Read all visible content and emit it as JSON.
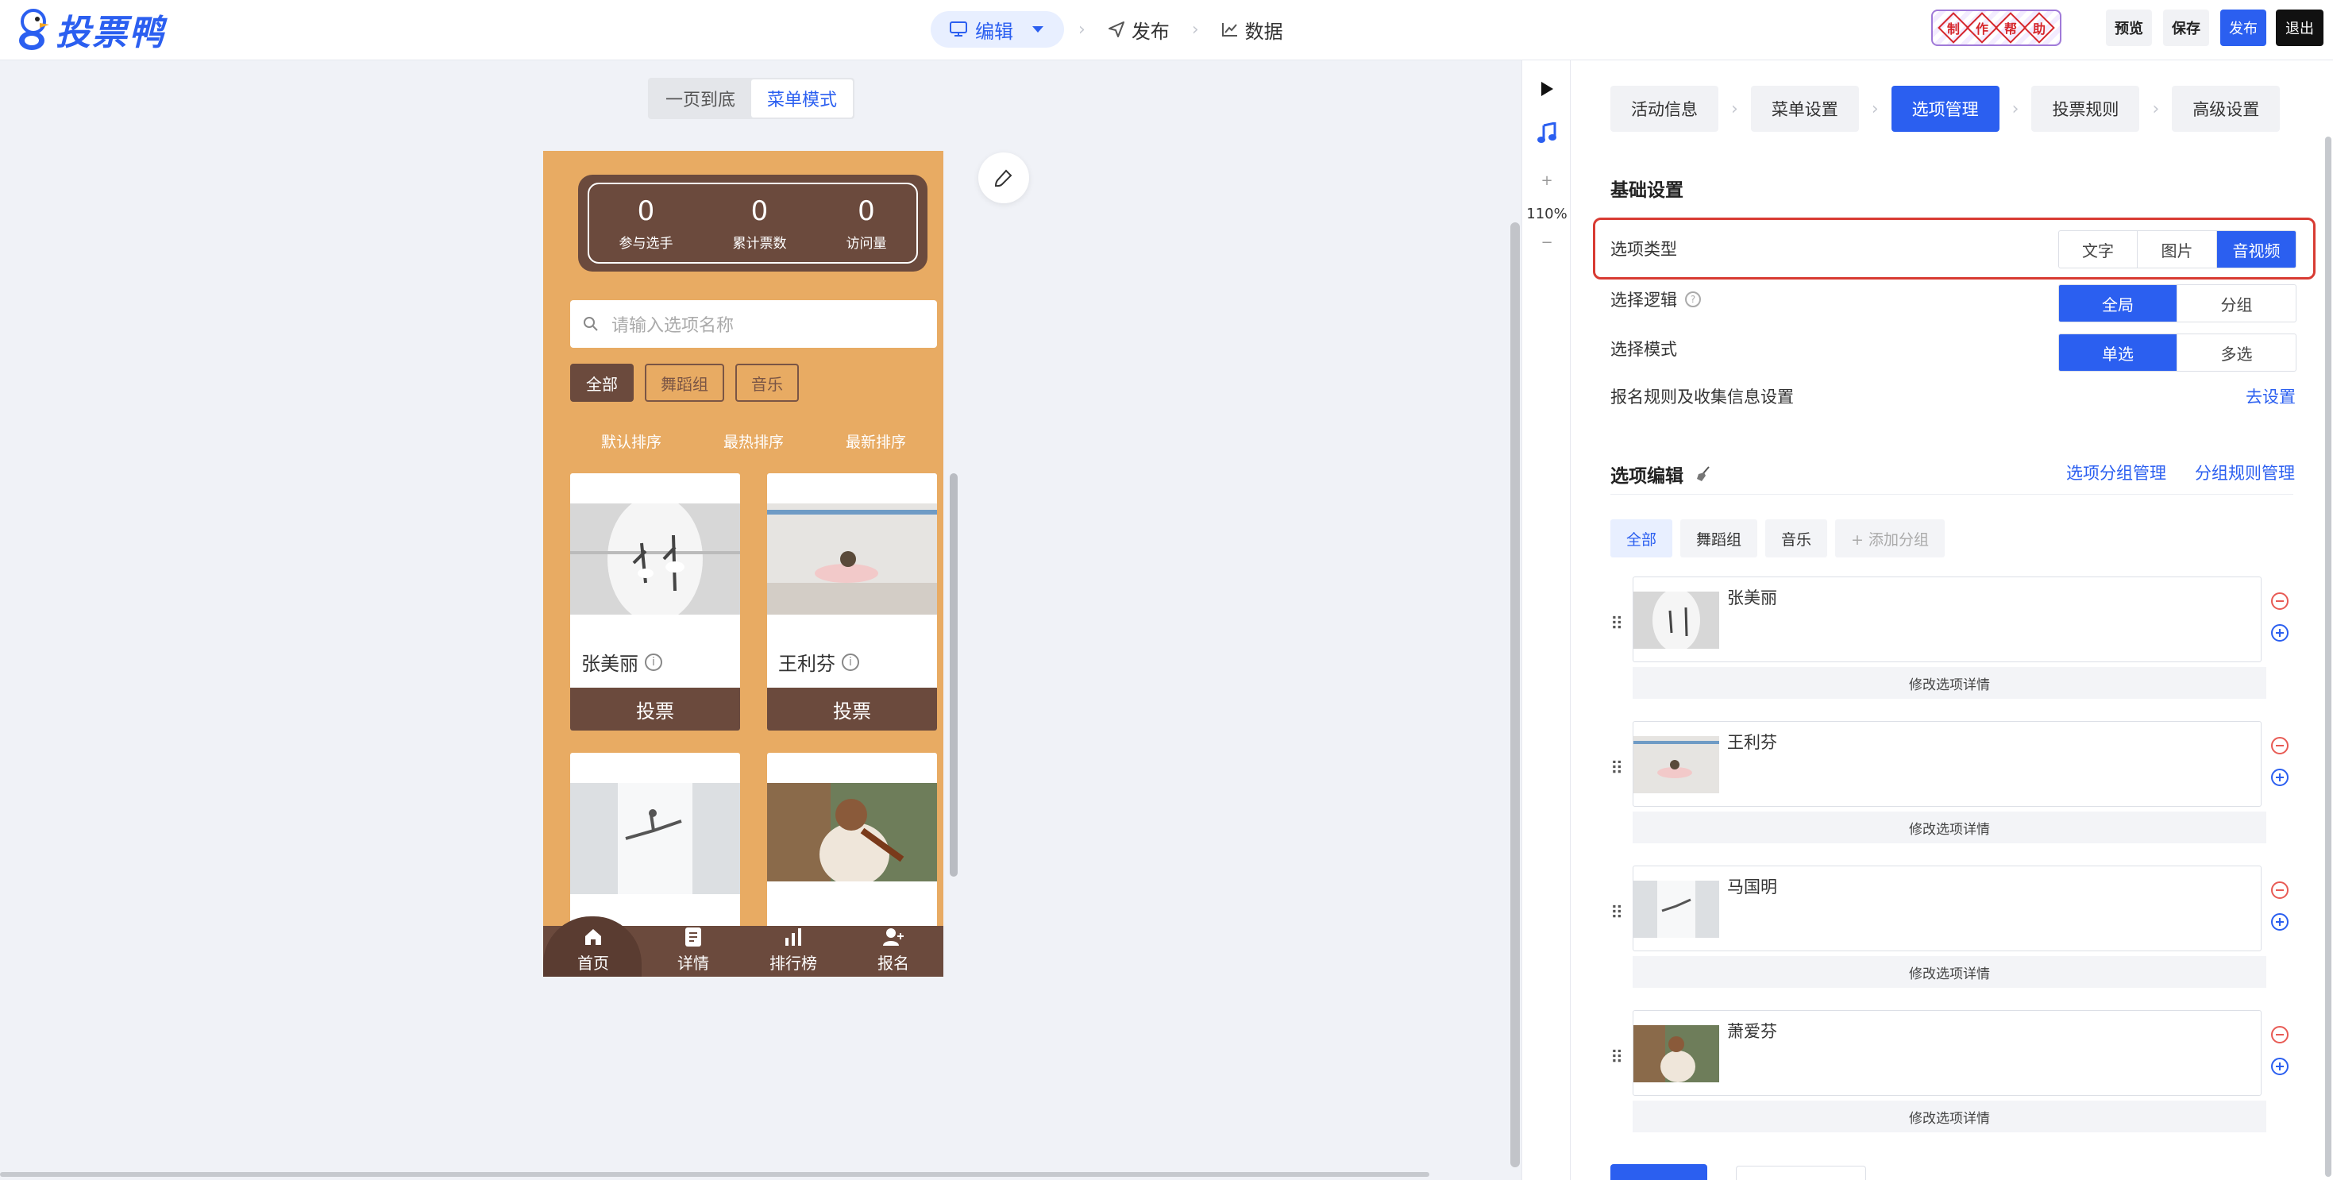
{
  "header": {
    "logo_text": "投票鸭",
    "nav": [
      {
        "label": "编辑",
        "icon": "monitor-icon"
      },
      {
        "label": "发布",
        "icon": "send-icon"
      },
      {
        "label": "数据",
        "icon": "chart-line-icon"
      }
    ],
    "help_badge_chars": [
      "制",
      "作",
      "帮",
      "助"
    ],
    "buttons": {
      "preview": "预览",
      "save": "保存",
      "publish": "发布",
      "exit": "退出"
    }
  },
  "canvas": {
    "mode_tabs": [
      "一页到底",
      "菜单模式"
    ],
    "active_mode": "菜单模式",
    "stats": [
      {
        "value": "0",
        "label": "参与选手"
      },
      {
        "value": "0",
        "label": "累计票数"
      },
      {
        "value": "0",
        "label": "访问量"
      }
    ],
    "search_placeholder": "请输入选项名称",
    "groups": [
      "全部",
      "舞蹈组",
      "音乐"
    ],
    "sorts": [
      "默认排序",
      "最热排序",
      "最新排序"
    ],
    "cards": [
      {
        "name": "张美丽",
        "vote": "投票"
      },
      {
        "name": "王利芬",
        "vote": "投票"
      }
    ],
    "tabbar": [
      {
        "label": "首页",
        "icon": "home-icon"
      },
      {
        "label": "详情",
        "icon": "document-icon"
      },
      {
        "label": "排行榜",
        "icon": "bar-chart-icon"
      },
      {
        "label": "报名",
        "icon": "user-add-icon"
      }
    ]
  },
  "tools": {
    "zoom": "110%",
    "plus": "+",
    "minus": "−"
  },
  "panel": {
    "steps": [
      "活动信息",
      "菜单设置",
      "选项管理",
      "投票规则",
      "高级设置"
    ],
    "active_step": "选项管理",
    "basic_title": "基础设置",
    "option_type": {
      "label": "选项类型",
      "options": [
        "文字",
        "图片",
        "音视频"
      ],
      "selected": "音视频"
    },
    "select_logic": {
      "label": "选择逻辑",
      "options": [
        "全局",
        "分组"
      ],
      "selected": "全局"
    },
    "select_mode": {
      "label": "选择模式",
      "options": [
        "单选",
        "多选"
      ],
      "selected": "单选"
    },
    "signup_rules": {
      "label": "报名规则及收集信息设置",
      "link": "去设置"
    },
    "edit_title": "选项编辑",
    "edit_links": [
      "选项分组管理",
      "分组规则管理"
    ],
    "group_tabs": [
      "全部",
      "舞蹈组",
      "音乐",
      "+ 添加分组"
    ],
    "options": [
      {
        "name": "张美丽",
        "edit": "修改选项详情"
      },
      {
        "name": "王利芬",
        "edit": "修改选项详情"
      },
      {
        "name": "马国明",
        "edit": "修改选项详情"
      },
      {
        "name": "萧爱芬",
        "edit": "修改选项详情"
      }
    ]
  },
  "colors": {
    "accent": "#2b5ff0",
    "phone_bg": "#e8ab63",
    "phone_dark": "#6b4a3d",
    "highlight": "#d83b33"
  }
}
